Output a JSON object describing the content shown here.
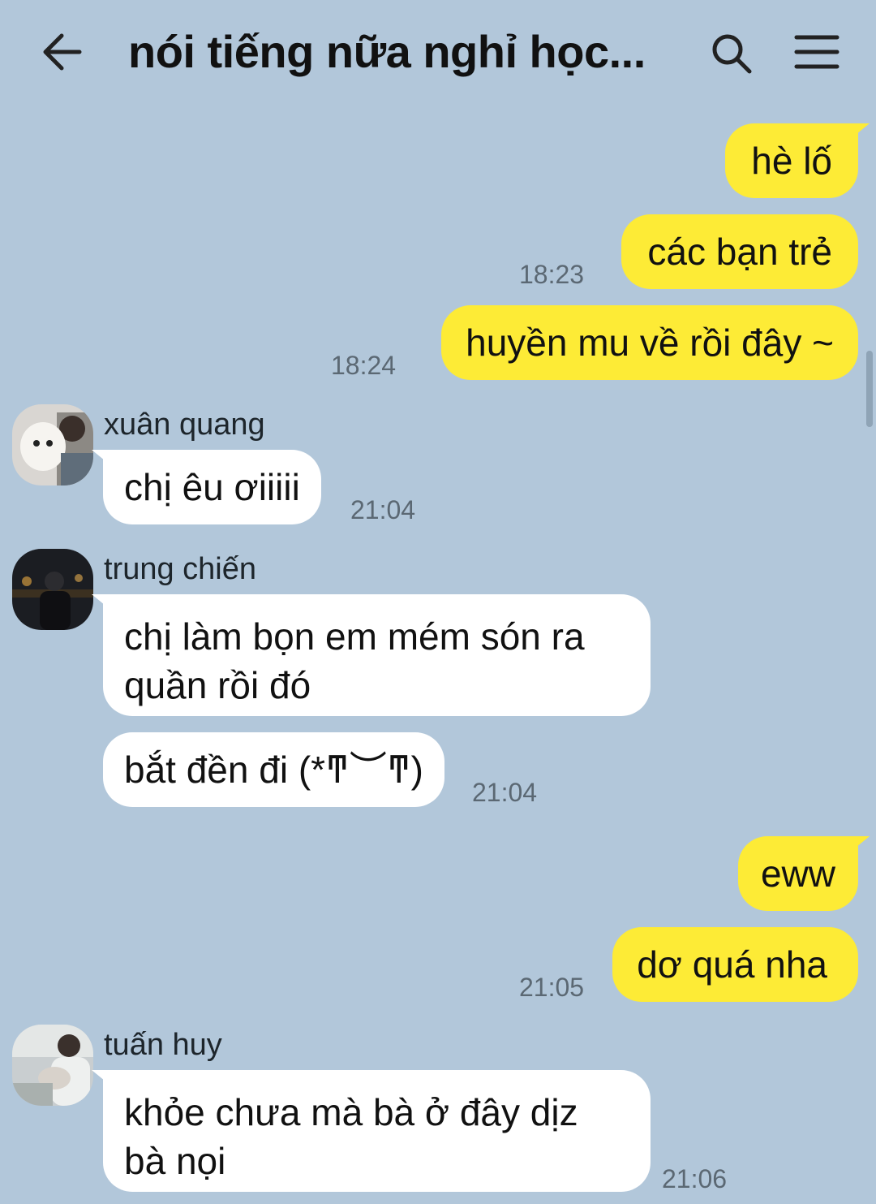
{
  "header": {
    "title": "nói tiếng nữa nghỉ học..."
  },
  "messages": {
    "m1": "hè lố",
    "m2": "các bạn trẻ",
    "m2_time": "18:23",
    "m3": "huyền mu về rồi đây ~",
    "m3_time": "18:24",
    "xuan_name": "xuân quang",
    "m4": "chị êu ơiiiii",
    "m4_time": "21:04",
    "trung_name": "trung chiến",
    "m5": "chị làm bọn em mém són ra quần rồi đó",
    "m6": "bắt đền đi (*ͳ︶ͳ)",
    "m6_time": "21:04",
    "m7": "eww",
    "m8": "dơ quá nha",
    "m8_time": "21:05",
    "tuan_name": "tuấn huy",
    "m9": "khỏe chưa mà bà ở đây dịz bà nọi",
    "m9_time": "21:06"
  },
  "colors": {
    "background": "#b2c7da",
    "my_bubble": "#fdeb36",
    "their_bubble": "#ffffff"
  },
  "icons": {
    "back": "arrow-left-icon",
    "search": "search-icon",
    "menu": "hamburger-menu-icon"
  }
}
